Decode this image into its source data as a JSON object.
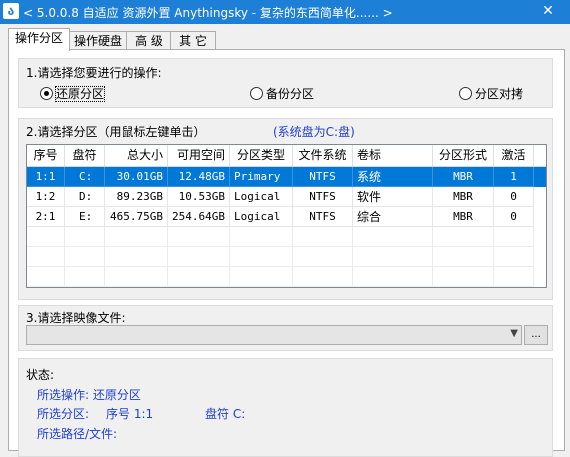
{
  "window": {
    "title": "< 5.0.0.8 自适应 资源外置 Anythingsky - 复杂的东西简单化...... >",
    "icon": "app-icon",
    "close_glyph": "✕"
  },
  "tabs": [
    {
      "label": "操作分区",
      "active": true
    },
    {
      "label": "操作硬盘",
      "active": false
    },
    {
      "label": "高 级",
      "active": false
    },
    {
      "label": "其 它",
      "active": false
    }
  ],
  "section1": {
    "label": "1.请选择您要进行的操作:",
    "options": [
      {
        "label": "还原分区",
        "checked": true
      },
      {
        "label": "备份分区",
        "checked": false
      },
      {
        "label": "分区对拷",
        "checked": false
      }
    ]
  },
  "section2": {
    "label": "2.请选择分区（用鼠标左键单击）",
    "system_disk_note": "(系统盘为C:盘)",
    "columns": [
      "序号",
      "盘符",
      "总大小",
      "可用空间",
      "分区类型",
      "文件系统",
      "卷标",
      "分区形式",
      "激活"
    ],
    "rows": [
      {
        "cells": [
          "1:1",
          "C:",
          "30.01GB",
          "12.48GB",
          "Primary",
          "NTFS",
          "系统",
          "MBR",
          "1"
        ],
        "selected": true
      },
      {
        "cells": [
          "1:2",
          "D:",
          "89.23GB",
          "10.53GB",
          "Logical",
          "NTFS",
          "软件",
          "MBR",
          "0"
        ],
        "selected": false
      },
      {
        "cells": [
          "2:1",
          "E:",
          "465.75GB",
          "254.64GB",
          "Logical",
          "NTFS",
          "综合",
          "MBR",
          "0"
        ],
        "selected": false
      }
    ]
  },
  "section3": {
    "label": "3.请选择映像文件:",
    "image_file_value": "",
    "browse_label": "..."
  },
  "status": {
    "heading": "状态:",
    "operation": "所选操作: 还原分区",
    "partition_label": "所选分区:",
    "seq": "序号 1:1",
    "drive": "盘符 C:",
    "path_label": "所选路径/文件:"
  },
  "colors": {
    "titlebar": "#1e7fd6",
    "selection": "#0078d7",
    "note_text": "#1f3fd0"
  }
}
